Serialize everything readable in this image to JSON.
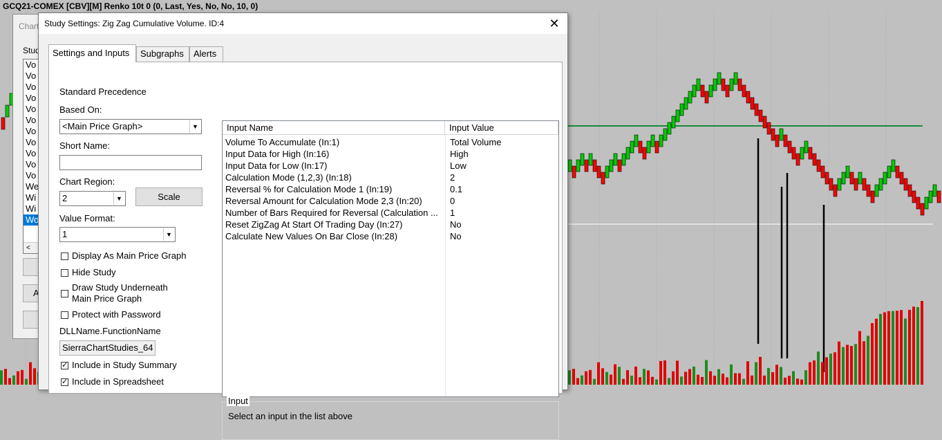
{
  "chart": {
    "title": "GCQ21-COMEX [CBV][M] Renko 10t 0  (0, Last, Yes, No, No, 10, 0)",
    "colors": {
      "up": "#00cc00",
      "down": "#ff0000",
      "horizontal_line": "#1a8a3a",
      "white_line": "#ffffff",
      "volume_up": "#1f8a1f",
      "volume_down": "#e00000",
      "zigzag_line": "#000000"
    }
  },
  "background_dialog": {
    "title": "Chart",
    "studies_label": "Stud",
    "list_items": [
      "Vo",
      "Vo",
      "Vo",
      "Vo",
      "Vo",
      "Vo",
      "Vo",
      "Vo",
      "Vo",
      "Vo",
      "Vo",
      "We",
      "Wi",
      "Wi",
      "Wo"
    ],
    "selected_index": 14,
    "scroll_left": "<",
    "button_a_label": "A"
  },
  "dialog": {
    "title": "Study Settings: Zig Zag Cumulative Volume. ID:4",
    "close_icon": "close-icon",
    "tabs": [
      {
        "label": "Settings and Inputs",
        "active": true
      },
      {
        "label": "Subgraphs",
        "active": false
      },
      {
        "label": "Alerts",
        "active": false
      }
    ],
    "left": {
      "standard_precedence": "Standard Precedence",
      "based_on_label": "Based On:",
      "based_on_value": "<Main Price Graph>",
      "short_name_label": "Short Name:",
      "short_name_value": "",
      "chart_region_label": "Chart Region:",
      "chart_region_value": "2",
      "scale_button": "Scale",
      "value_format_label": "Value Format:",
      "value_format_value": "1",
      "display_main_price": {
        "label": "Display As Main Price Graph",
        "checked": false
      },
      "hide_study": {
        "label": "Hide Study",
        "checked": false
      },
      "draw_underneath": {
        "label_line1": "Draw Study Underneath",
        "label_line2": "Main Price Graph",
        "checked": false
      },
      "protect_password": {
        "label": "Protect with Password",
        "checked": false
      },
      "dll_label": "DLLName.FunctionName",
      "dll_value": "SierraChartStudies_64",
      "include_summary": {
        "label": "Include in Study Summary",
        "checked": true
      },
      "include_spreadsheet": {
        "label": "Include in Spreadsheet",
        "checked": true
      }
    },
    "grid": {
      "headers": [
        "Input Name",
        "Input Value"
      ],
      "rows": [
        {
          "name": "Volume To Accumulate   (In:1)",
          "value": "Total Volume"
        },
        {
          "name": "Input Data for High   (In:16)",
          "value": "High"
        },
        {
          "name": "Input Data for Low   (In:17)",
          "value": "Low"
        },
        {
          "name": "Calculation Mode (1,2,3)   (In:18)",
          "value": "2"
        },
        {
          "name": "Reversal % for Calculation Mode 1   (In:19)",
          "value": "0.1"
        },
        {
          "name": "Reversal Amount for Calculation Mode 2,3   (In:20)",
          "value": "0"
        },
        {
          "name": "Number of Bars Required for Reversal (Calculation ...",
          "value": "1"
        },
        {
          "name": "Reset ZigZag At Start Of Trading Day   (In:27)",
          "value": "No"
        },
        {
          "name": "Calculate New Values On Bar Close   (In:28)",
          "value": "No"
        }
      ]
    },
    "input_group": {
      "legend": "Input",
      "hint": "Select an input in the list above"
    }
  }
}
